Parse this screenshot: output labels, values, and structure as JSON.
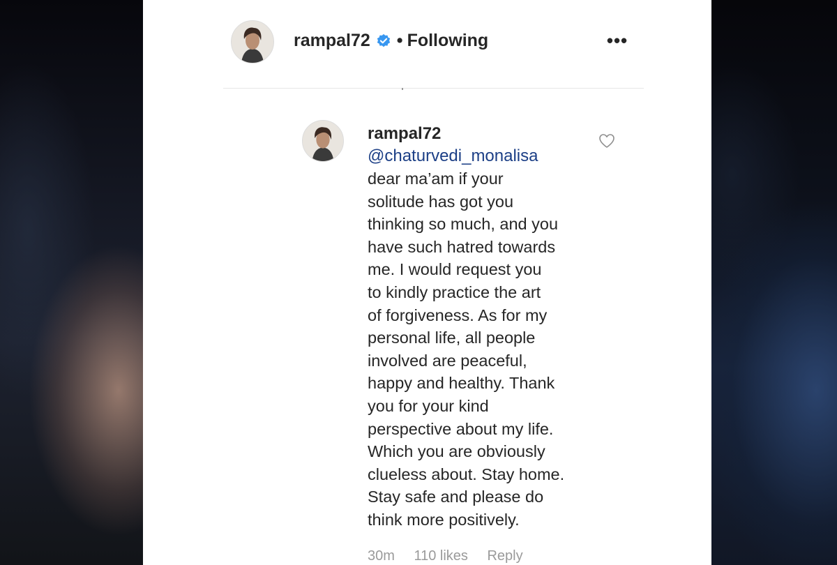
{
  "post_header": {
    "username": "rampal72",
    "separator": "•",
    "follow_status": "Following",
    "more_label": "•••"
  },
  "comment": {
    "username": "rampal72",
    "mention": "@chaturvedi_monalisa",
    "lines": [
      "dear ma’am if your",
      "solitude has got you",
      "thinking so much, and you",
      "have such hatred towards",
      "me. I would request you",
      "to kindly practice the art",
      "of forgiveness. As for my",
      "personal life, all people",
      "involved are peaceful,",
      "happy and healthy. Thank",
      "you for your kind",
      "perspective about my life.",
      "Which you are obviously",
      "clueless about. Stay home.",
      "Stay safe and please do",
      "think more positively."
    ],
    "meta": {
      "time": "30m",
      "likes": "110 likes",
      "reply": "Reply"
    }
  },
  "icons": {
    "verified": "verified-badge-icon",
    "heart": "heart-outline-icon",
    "more": "more-options-icon"
  },
  "colors": {
    "verified_blue": "#3897f0",
    "mention_blue": "#1c3f86",
    "text": "#262626",
    "muted": "#9a9a9a"
  }
}
